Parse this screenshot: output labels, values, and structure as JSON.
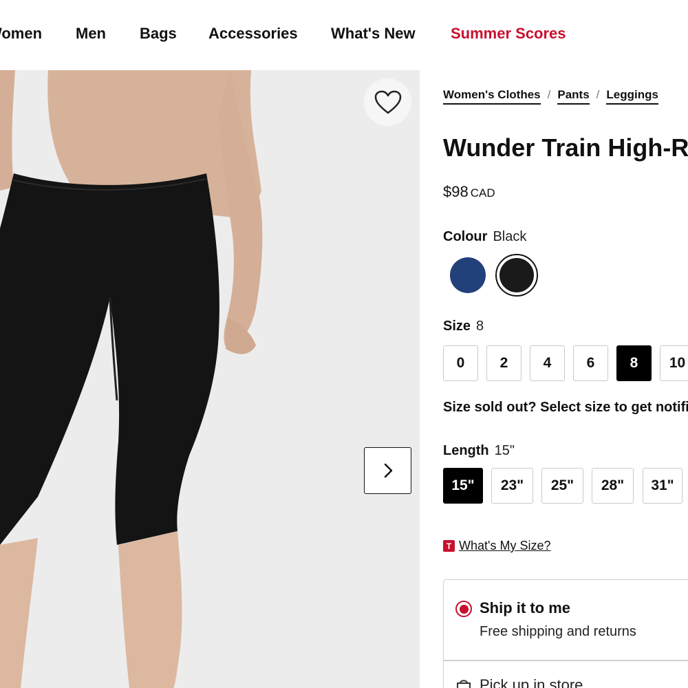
{
  "nav": {
    "items": [
      {
        "label": "Women",
        "accent": false
      },
      {
        "label": "Men",
        "accent": false
      },
      {
        "label": "Bags",
        "accent": false
      },
      {
        "label": "Accessories",
        "accent": false
      },
      {
        "label": "What's New",
        "accent": false
      },
      {
        "label": "Summer Scores",
        "accent": true
      }
    ]
  },
  "gallery": {
    "wishlist_icon": "heart-icon",
    "next_icon": "chevron-right-icon"
  },
  "breadcrumb": [
    "Women's Clothes",
    "Pants",
    "Leggings"
  ],
  "breadcrumb_separator": "/",
  "product": {
    "title": "Wunder Train High-Rise",
    "price": "$98",
    "currency": "CAD"
  },
  "colour": {
    "label": "Colour",
    "selected": "Black",
    "swatches": [
      {
        "name": "Navy",
        "hex": "#22407a",
        "selected": false
      },
      {
        "name": "Black",
        "hex": "#1a1a1a",
        "selected": true
      }
    ]
  },
  "size": {
    "label": "Size",
    "selected": "8",
    "options": [
      "0",
      "2",
      "4",
      "6",
      "8",
      "10"
    ],
    "soldout_text": "Size sold out? Select size to get notified"
  },
  "length": {
    "label": "Length",
    "selected": "15\"",
    "options": [
      "15\"",
      "23\"",
      "25\"",
      "28\"",
      "31\""
    ]
  },
  "fit": {
    "badge": "T",
    "link": "What's My Size?"
  },
  "shipping": {
    "ship_title": "Ship it to me",
    "ship_sub": "Free shipping and returns",
    "pickup_title": "Pick up in store",
    "pickup_icon": "store-bag-icon"
  },
  "colors": {
    "accent": "#c8102e",
    "selected_bg": "#000000",
    "gallery_bg": "#ececec"
  }
}
